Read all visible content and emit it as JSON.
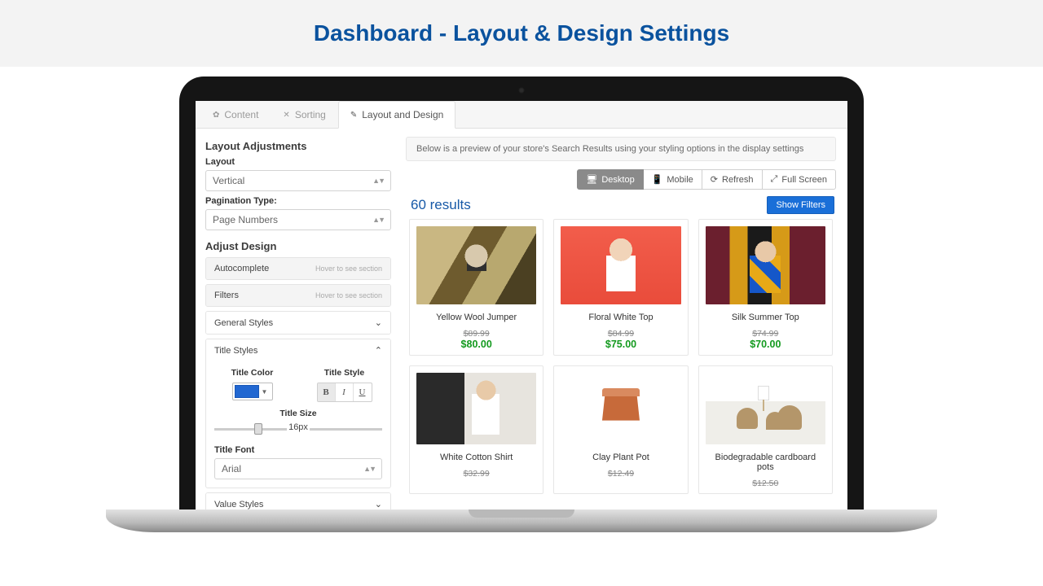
{
  "banner": {
    "title": "Dashboard - Layout & Design Settings"
  },
  "tabs": {
    "content": "Content",
    "sorting": "Sorting",
    "layout": "Layout and Design"
  },
  "left": {
    "adjustments_title": "Layout Adjustments",
    "layout_label": "Layout",
    "layout_value": "Vertical",
    "pagination_label": "Pagination Type:",
    "pagination_value": "Page Numbers",
    "design_title": "Adjust Design",
    "hover_hint": "Hover to see section",
    "panels": {
      "autocomplete": "Autocomplete",
      "filters": "Filters",
      "general": "General Styles",
      "title_styles": "Title Styles",
      "value_styles": "Value Styles"
    },
    "title_styles": {
      "color_label": "Title Color",
      "color_value": "#2167d1",
      "style_label": "Title Style",
      "size_label": "Title Size",
      "size_value": "16px",
      "font_label": "Title Font",
      "font_value": "Arial"
    }
  },
  "preview": {
    "info": "Below is a preview of your store's Search Results using your styling options in the display settings",
    "toolbar": {
      "desktop": "Desktop",
      "mobile": "Mobile",
      "refresh": "Refresh",
      "full": "Full Screen"
    },
    "results_count": "60 results",
    "show_filters": "Show Filters",
    "products": [
      {
        "name": "Yellow Wool Jumper",
        "old": "$89.99",
        "new": "$80.00"
      },
      {
        "name": "Floral White Top",
        "old": "$84.99",
        "new": "$75.00"
      },
      {
        "name": "Silk Summer Top",
        "old": "$74.99",
        "new": "$70.00"
      },
      {
        "name": "White Cotton Shirt",
        "old": "$32.99",
        "new": ""
      },
      {
        "name": "Clay Plant Pot",
        "old": "$12.49",
        "new": ""
      },
      {
        "name": "Biodegradable cardboard pots",
        "old": "$12.50",
        "new": ""
      }
    ]
  }
}
